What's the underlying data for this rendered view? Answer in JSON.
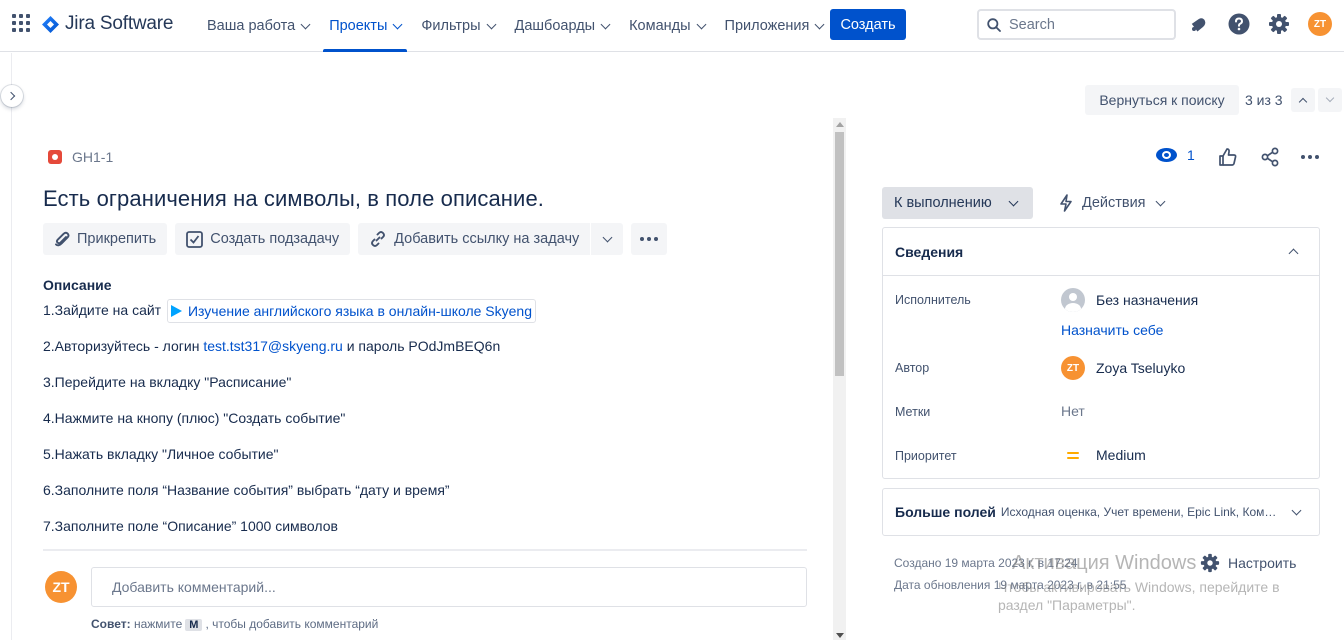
{
  "app": {
    "name": "Jira Software",
    "brand_color": "#0052cc"
  },
  "nav": {
    "items": [
      {
        "label": "Ваша работа",
        "active": false
      },
      {
        "label": "Проекты",
        "active": true
      },
      {
        "label": "Фильтры",
        "active": false
      },
      {
        "label": "Дашбоарды",
        "active": false
      },
      {
        "label": "Команды",
        "active": false
      },
      {
        "label": "Приложения",
        "active": false
      }
    ],
    "create_label": "Создать",
    "search_placeholder": "Search",
    "user_initials": "ZT",
    "icons": [
      "app-switcher-icon",
      "notifications-icon",
      "help-icon",
      "settings-icon"
    ]
  },
  "issue_nav": {
    "back_label": "Вернуться к поиску",
    "position": "3 из 3"
  },
  "issue": {
    "key": "GH1-1",
    "type_icon": "bug-icon",
    "title": "Есть ограничения на символы, в поле описание.",
    "actions": {
      "attach": "Прикрепить",
      "subtask": "Создать подзадачу",
      "link": "Добавить ссылку на задачу"
    },
    "description_title": "Описание",
    "description": {
      "line1_prefix": "1.Зайдите на сайт",
      "line1_link": "Изучение английского языка в онлайн-школе Skyeng",
      "line2_prefix": "2.Авторизуйтесь - логин",
      "line2_email": "test.tst317@skyeng.ru",
      "line2_suffix": "и пароль POdJmBEQ6n",
      "line3": "3.Перейдите на вкладку \"Расписание\"",
      "line4": "4.Нажмите на кнопу (плюс) \"Создать событие\"",
      "line5": "5.Нажать вкладку \"Личное событие\"",
      "line6": "6.Заполните поля “Название события” выбрать “дату и время”",
      "line7": "7.Заполните поле “Описание” 1000 символов"
    },
    "comment": {
      "avatar": "ZT",
      "placeholder": "Добавить комментарий...",
      "tip_label": "Совет:",
      "tip_pre": "нажмите",
      "tip_key": "M",
      "tip_post": ", чтобы добавить комментарий"
    }
  },
  "sidebar": {
    "watch_count": "1",
    "status": "К выполнению",
    "actions_label": "Действия",
    "details_title": "Сведения",
    "fields": {
      "assignee_label": "Исполнитель",
      "assignee_value": "Без назначения",
      "assign_me": "Назначить себе",
      "reporter_label": "Автор",
      "reporter_value": "Zoya Tseluyko",
      "reporter_initials": "ZT",
      "labels_label": "Метки",
      "labels_value": "Нет",
      "priority_label": "Приоритет",
      "priority_value": "Medium"
    },
    "more_fields_title": "Больше полей",
    "more_fields_summary": "Исходная оценка, Учет времени, Epic Link, Компоненты",
    "created": "Создано 19 марта 2023 г. в 17:24",
    "updated": "Дата обновления 19 марта 2023 г. в 21:55",
    "configure": "Настроить"
  },
  "watermark": {
    "line1": "Активация Windows",
    "line2": "Чтобы активировать Windows, перейдите в",
    "line3": "раздел \"Параметры\"."
  }
}
